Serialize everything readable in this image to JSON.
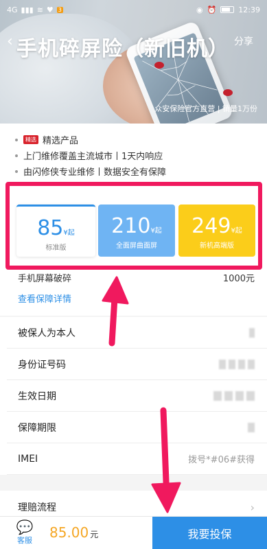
{
  "status_bar": {
    "left_signal": "4G",
    "app_badge": "3",
    "time": "12:39"
  },
  "hero": {
    "title": "手机碎屏险（新旧机）",
    "share_label": "分享",
    "subtitle": "众安保险官方直营 | 销量1万份"
  },
  "features": {
    "tag": "精选",
    "items": [
      "精选产品",
      "上门维修覆盖主流城市丨1天内响应",
      "由闪修侠专业维修丨数据安全有保障"
    ]
  },
  "plans": [
    {
      "price": "85",
      "unit": "¥起",
      "name": "标准版"
    },
    {
      "price": "210",
      "unit": "¥起",
      "name": "全面屏曲面屏"
    },
    {
      "price": "249",
      "unit": "¥起",
      "name": "新机高端版"
    }
  ],
  "coverage": {
    "item": "手机屏幕破碎",
    "amount": "1000元",
    "detail_link": "查看保障详情"
  },
  "form": {
    "insured_self": "被保人为本人",
    "id_number": "身份证号码",
    "effective_date": "生效日期",
    "period": "保障期限",
    "imei": "IMEI",
    "imei_placeholder": "拨号*#06#获得"
  },
  "claims": {
    "label": "理赔流程"
  },
  "bottom": {
    "service_label": "客服",
    "total": "85.00",
    "currency": "元",
    "buy_label": "我要投保"
  },
  "colors": {
    "accent": "#2d8fe6",
    "highlight": "#f0195e",
    "gold": "#fbcd1a"
  }
}
